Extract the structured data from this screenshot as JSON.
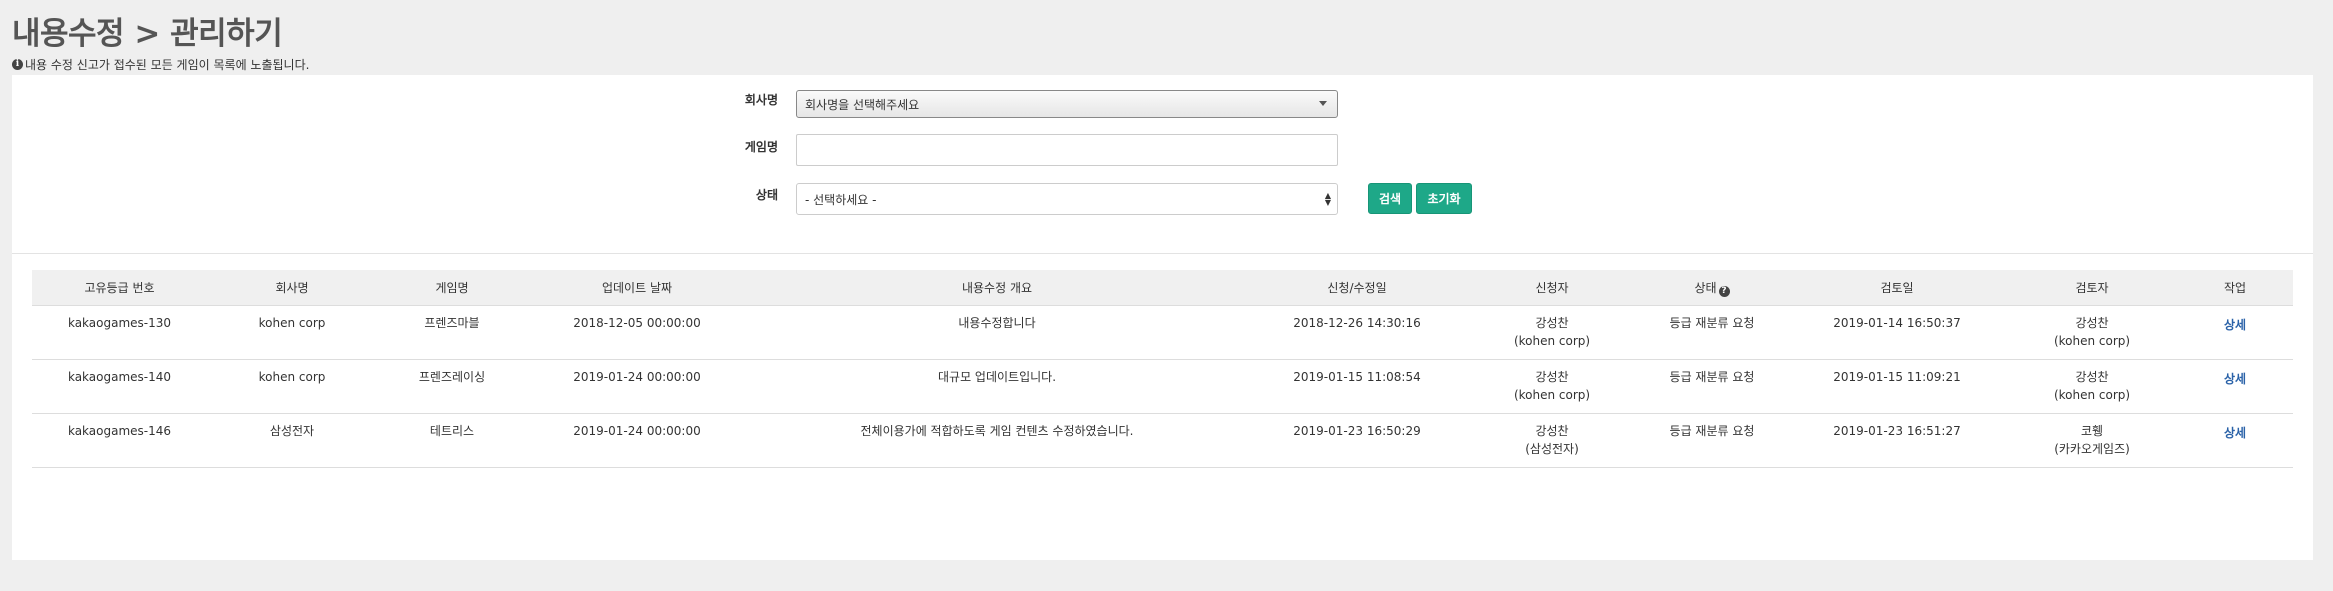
{
  "header": {
    "title": "내용수정 > 관리하기",
    "notice": "내용 수정 신고가 접수된 모든 게임이 목록에 노출됩니다."
  },
  "search": {
    "company_label": "회사명",
    "company_value": "회사명을 선택해주세요",
    "game_label": "게임명",
    "game_value": "",
    "status_label": "상태",
    "status_value": "- 선택하세요 -",
    "search_button": "검색",
    "reset_button": "초기화"
  },
  "table": {
    "columns": [
      "고유등급 번호",
      "회사명",
      "게임명",
      "업데이트 날짜",
      "내용수정 개요",
      "신청/수정일",
      "신청자",
      "상태",
      "검토일",
      "검토자",
      "작업"
    ],
    "rows": [
      {
        "id": "kakaogames-130",
        "company": "kohen corp",
        "game": "프렌즈마블",
        "update_date": "2018-12-05 00:00:00",
        "summary": "내용수정합니다",
        "applied": "2018-12-26 14:30:16",
        "applicant_name": "강성찬",
        "applicant_org": "(kohen corp)",
        "status": "등급 재분류 요청",
        "reviewed": "2019-01-14 16:50:37",
        "reviewer_name": "강성찬",
        "reviewer_org": "(kohen corp)",
        "action": "상세"
      },
      {
        "id": "kakaogames-140",
        "company": "kohen corp",
        "game": "프렌즈레이싱",
        "update_date": "2019-01-24 00:00:00",
        "summary": "대규모 업데이트입니다.",
        "applied": "2019-01-15 11:08:54",
        "applicant_name": "강성찬",
        "applicant_org": "(kohen corp)",
        "status": "등급 재분류 요청",
        "reviewed": "2019-01-15 11:09:21",
        "reviewer_name": "강성찬",
        "reviewer_org": "(kohen corp)",
        "action": "상세"
      },
      {
        "id": "kakaogames-146",
        "company": "삼성전자",
        "game": "테트리스",
        "update_date": "2019-01-24 00:00:00",
        "summary": "전체이용가에 적합하도록 게임 컨텐츠 수정하였습니다.",
        "applied": "2019-01-23 16:50:29",
        "applicant_name": "강성찬",
        "applicant_org": "(삼성전자)",
        "status": "등급 재분류 요청",
        "reviewed": "2019-01-23 16:51:27",
        "reviewer_name": "코휑",
        "reviewer_org": "(카카오게임즈)",
        "action": "상세"
      }
    ]
  },
  "icons": {
    "notice_icon": "info-circle-icon",
    "status_help_icon": "question-circle-icon"
  },
  "colors": {
    "primary_button": "#1ea888",
    "link": "#2a62a8"
  }
}
